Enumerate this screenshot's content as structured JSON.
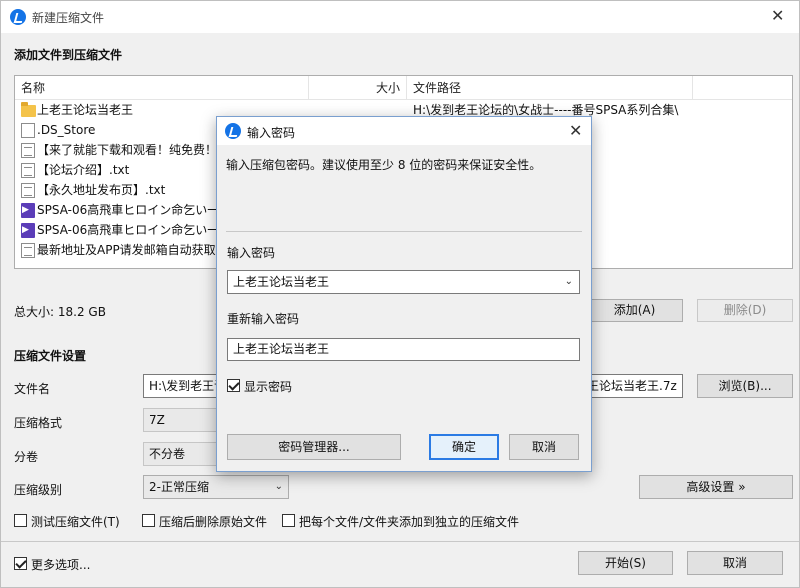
{
  "window": {
    "title": "新建压缩文件",
    "close_glyph": "✕"
  },
  "files_section": {
    "title": "添加文件到压缩文件",
    "columns": {
      "name": "名称",
      "size": "大小",
      "path": "文件路径"
    },
    "rows": [
      {
        "icon": "folder-icon",
        "name": "上老王论坛当老王",
        "path": "H:\\发到老王论坛的\\女战士----番号SPSA系列合集\\"
      },
      {
        "icon": "file-icon",
        "name": ".DS_Store",
        "path": "号SPSA系列合集\\"
      },
      {
        "icon": "text-file-icon",
        "name": "【来了就能下载和观看！纯免费！】",
        "path": "号SPSA系列合集\\"
      },
      {
        "icon": "text-file-icon",
        "name": "【论坛介绍】.txt",
        "path": "号SPSA系列合集\\"
      },
      {
        "icon": "text-file-icon",
        "name": "【永久地址发布页】.txt",
        "path": "号SPSA系列合集\\"
      },
      {
        "icon": "video-file-icon",
        "name": "SPSA-06高飛車ヒロイン命乞い一",
        "path": "号SPSA系列合集\\"
      },
      {
        "icon": "video-file-icon",
        "name": "SPSA-06高飛車ヒロイン命乞い一",
        "path": "号SPSA系列合集\\"
      },
      {
        "icon": "text-file-icon",
        "name": "最新地址及APP请发邮箱自动获取！",
        "path": "号SPSA系列合集\\"
      }
    ],
    "total_size": "总大小: 18.2 GB",
    "add_button": "添加(A)",
    "delete_button": "删除(D)"
  },
  "settings_section": {
    "title": "压缩文件设置",
    "filename_label": "文件名",
    "filename_value": "H:\\发到老王论",
    "filename_suffix": "王论坛当老王.7z",
    "browse_button": "浏览(B)...",
    "format_label": "压缩格式",
    "format_value": "7Z",
    "volume_label": "分卷",
    "volume_value": "不分卷",
    "level_label": "压缩级别",
    "level_value": "2-正常压缩",
    "advanced_button": "高级设置 »",
    "option_test": "测试压缩文件(T)",
    "option_delete": "压缩后删除原始文件",
    "option_each": "把每个文件/文件夹添加到独立的压缩文件",
    "more_options": "更多选项...",
    "start_button": "开始(S)",
    "cancel_button": "取消"
  },
  "dialog": {
    "title": "输入密码",
    "close_glyph": "✕",
    "description": "输入压缩包密码。建议使用至少 8 位的密码来保证安全性。",
    "password_label": "输入密码",
    "password_value": "上老王论坛当老王",
    "confirm_label": "重新输入密码",
    "confirm_value": "上老王论坛当老王",
    "show_password_label": "显示密码",
    "show_password_checked": true,
    "manager_button": "密码管理器...",
    "ok_button": "确定",
    "cancel_button": "取消"
  },
  "colors": {
    "accent": "#1473e6",
    "window_bg": "#f0f0f0",
    "dialog_border": "#7a9fcf"
  }
}
